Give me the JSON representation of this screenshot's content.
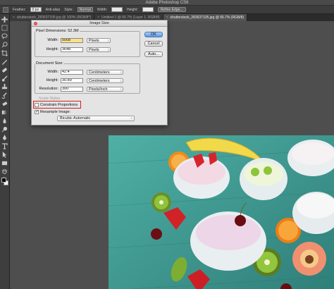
{
  "app": {
    "title": "Adobe Photoshop CS6"
  },
  "options_bar": {
    "feather_label": "Feather:",
    "feather_value": "0 px",
    "antialias_label": "Anti-alias",
    "style_label": "Style:",
    "style_value": "Normal",
    "width_label": "Width:",
    "height_label": "Height:",
    "refine_edge_label": "Refine Edge..."
  },
  "tabs": [
    {
      "label": "shutterstock_283637105.jpg @ 100% (RGB/8*)",
      "active": false
    },
    {
      "label": "Untitled-1 @ 66.7% (Layer 1, RGB/8)",
      "active": false
    },
    {
      "label": "shutterstock_283637105.jpg @ 66.7% (RGB/8)",
      "active": true
    }
  ],
  "dialog": {
    "title": "Image Size",
    "pixel_dimensions": {
      "legend": "Pixel Dimensions:",
      "size": "52.3M",
      "width_label": "Width:",
      "width_value": "5008",
      "width_unit": "Pixels",
      "height_label": "Height:",
      "height_value": "3648",
      "height_unit": "Pixels"
    },
    "document_size": {
      "legend": "Document Size:",
      "width_label": "Width:",
      "width_value": "42.4",
      "width_unit": "Centimeters",
      "height_label": "Height:",
      "height_value": "30.89",
      "height_unit": "Centimeters",
      "resolution_label": "Resolution:",
      "resolution_value": "300",
      "resolution_unit": "Pixels/Inch"
    },
    "scale_styles_label": "Scale Styles",
    "constrain_label": "Constrain Proportions",
    "resample_label": "Resample Image:",
    "resample_value": "Bicubic Automatic",
    "ok_label": "OK",
    "cancel_label": "Cancel",
    "auto_label": "Auto..."
  },
  "colors": {
    "highlight": "#d42020",
    "canvas_bg": "#4e4e4e",
    "photo_bg": "#3a9a92"
  }
}
